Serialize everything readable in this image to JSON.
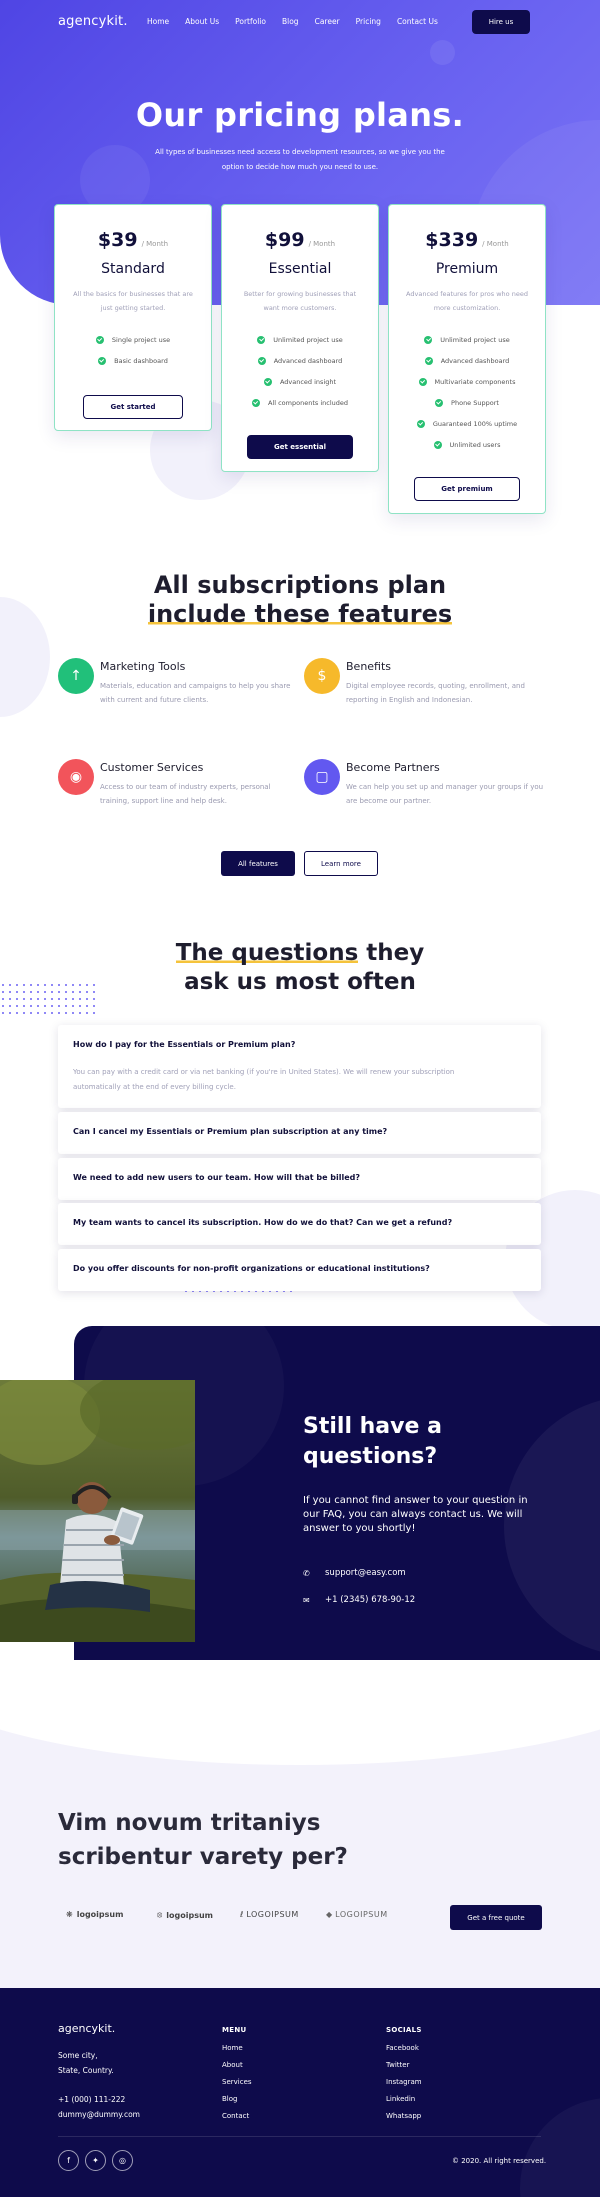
{
  "nav": {
    "logo": "agencykit.",
    "links": [
      "Home",
      "About Us",
      "Portfolio",
      "Blog",
      "Career",
      "Pricing",
      "Contact Us"
    ],
    "cta": "Hire us"
  },
  "hero": {
    "title": "Our pricing plans.",
    "subtitle": "All types of businesses need access to development resources, so we give you the option to decide how much you need to use."
  },
  "plans": [
    {
      "price": "$39",
      "period": "/ Month",
      "name": "Standard",
      "description": "All the basics for businesses that are just getting started.",
      "features": [
        "Single project use",
        "Basic dashboard"
      ],
      "button": "Get started"
    },
    {
      "price": "$99",
      "period": "/ Month",
      "name": "Essential",
      "description": "Better for growing businesses that want more customers.",
      "features": [
        "Unlimited project use",
        "Advanced dashboard",
        "Advanced insight",
        "All components included"
      ],
      "button": "Get essential"
    },
    {
      "price": "$339",
      "period": "/ Month",
      "name": "Premium",
      "description": "Advanced features for pros who need more customization.",
      "features": [
        "Unlimited project use",
        "Advanced dashboard",
        "Multivariate components",
        "Phone Support",
        "Guaranteed 100% uptime",
        "Unlimited users"
      ],
      "button": "Get premium"
    }
  ],
  "features_section": {
    "title_line1": "All subscriptions plan",
    "title_line2": "include these features",
    "items": [
      {
        "title": "Marketing Tools",
        "text": "Materials, education and campaigns to help you share with current and future clients.",
        "icon": "arrow-up-icon",
        "color": "#21c07a"
      },
      {
        "title": "Benefits",
        "text": "Digital employee records, quoting, enrollment, and reporting in English and Indonesian.",
        "icon": "dollar-icon",
        "color": "#f6b92b"
      },
      {
        "title": "Customer Services",
        "text": "Access to our team of industry experts, personal training, support line and help desk.",
        "icon": "globe-icon",
        "color": "#f2545b"
      },
      {
        "title": "Become Partners",
        "text": "We can help you set up and manager your groups if you are become our partner.",
        "icon": "monitor-icon",
        "color": "#6258f0"
      }
    ],
    "btn_primary": "All features",
    "btn_secondary": "Learn more"
  },
  "faq": {
    "title_hl": "The questions",
    "title_rest": " they",
    "title_line2": "ask us most often",
    "items": [
      {
        "q": "How do I pay for the Essentials or Premium plan?",
        "a": "You can pay with a credit card or via net banking (if you're in United States). We will renew your subscription automatically at the end of every billing cycle."
      },
      {
        "q": "Can I cancel my Essentials or Premium plan subscription at any time?"
      },
      {
        "q": "We need to add new users to our team. How will that be billed?"
      },
      {
        "q": "My team wants to cancel its subscription. How do we do that? Can we get a refund?"
      },
      {
        "q": "Do you offer discounts for non-profit organizations or educational institutions?"
      }
    ]
  },
  "contact": {
    "title": "Still have a questions?",
    "text": "If you cannot find answer to your question in our FAQ, you can always contact us. We will answer to you shortly!",
    "email": "support@easy.com",
    "phone": "+1 (2345) 678-90-12"
  },
  "partners": {
    "title": "Vim novum tritaniys scribentur varety per?",
    "logos": [
      "logoipsum",
      "logoipsum",
      "LOGOIPSUM",
      "LOGOIPSUM"
    ],
    "cta": "Get a free quote"
  },
  "footer": {
    "logo": "agencykit.",
    "address_line1": "Some city,",
    "address_line2": "State, Country.",
    "phone": "+1 (000) 111-222",
    "email": "dummy@dummy.com",
    "menu_title": "MENU",
    "menu": [
      "Home",
      "About",
      "Services",
      "Blog",
      "Contact"
    ],
    "socials_title": "SOCIALS",
    "socials": [
      "Facebook",
      "Twitter",
      "Instagram",
      "Linkedin",
      "Whatsapp"
    ],
    "social_icons": [
      "facebook-icon",
      "twitter-icon",
      "instagram-icon"
    ],
    "copyright": "© 2020. All right reserved."
  }
}
